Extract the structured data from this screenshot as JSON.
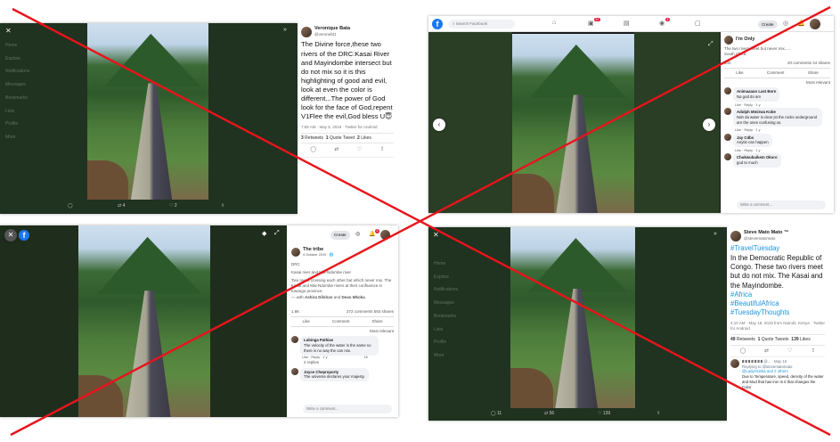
{
  "panel_tl": {
    "user_name": "Veronique Bata",
    "user_handle": "@veronebt1",
    "text": "The Divine force,these two rivers of the DRC:Kasai River and Mayindombe intersect but do not mix so it is this highlighting of good and evil, look at even the color is different...The power of God look for the face of God,repent V1Flee the evil,God bless U😇",
    "meta": "7:58 AM · May 5, 2019 · Twitter for Android",
    "retweets": "3",
    "retweets_label": "Retweets",
    "quote": "1",
    "quote_label": "Quote Tweet",
    "likes": "2",
    "likes_label": "Likes",
    "bar_retweets": "4",
    "bar_likes": "2"
  },
  "panel_tr": {
    "search_placeholder": "Search Facebook",
    "create_label": "Create",
    "badge1": "9+",
    "badge2": "4",
    "poster": "I'm Only",
    "text_line1": "The two rivers meet but never mix......",
    "text_line2": "South Africa.",
    "reactions": "102",
    "comments_shares": "20 comments 44 shares",
    "like_label": "Like",
    "comment_label": "Comment",
    "share_label": "Share",
    "sort_label": "Most relevant",
    "comments": [
      {
        "name": "Animaaaun Last Born",
        "text": "Na god do am"
      },
      {
        "name": "Adolph Mmirwa Kobe",
        "text": "Nah da water is clear jst the rocks underground are the ones confusing us."
      },
      {
        "name": "Jay Cdbs",
        "text": "Anytin can happen"
      },
      {
        "name": "Chukwubuikem Okoro",
        "text": "god to much"
      }
    ],
    "meta_like": "Like · Reply · 1 y",
    "write_comment": "Write a comment..."
  },
  "panel_bl": {
    "create_label": "Create",
    "badge": "2",
    "page_name": "The tribe",
    "date": "4 October 2019 · 🌐",
    "line1": "DRC",
    "line2": "Kasai river and Mai-Ndombe river",
    "line3": "Two rivers crossing each other but which never mix. The Kasai and Mai-Ndombe rivers at their confluence in Kwango province.",
    "line4_prefix": "— with ",
    "with1": "Ashira Dilshan",
    "with_and": " and ",
    "with2": "Dean Mkoka",
    "reactions": "1.6K",
    "comments_shares": "272 comments 593 shares",
    "like_label": "Like",
    "comment_label": "Comment",
    "share_label": "Share",
    "sort_label": "Most relevant",
    "comment1_name": "Lubinga Pathias",
    "comment1_text": "The velocity of the water is the same so there is no way the can mix.",
    "comment1_meta": "Like · Reply · 1 y",
    "comment1_count": "16",
    "replies": "2 replies",
    "comment2_name": "Joyce Cheproporty",
    "comment2_text": "The universe declares your majesty.",
    "write_comment": "Write a comment..."
  },
  "panel_br": {
    "user_name": "Steve Mato Mato ™",
    "user_handle": "@stevematomato",
    "hashtag1": "#TravelTuesday",
    "text": "In the Democratic Republic of Congo. These two rivers meet but do not mix. The Kasai and the Mayindombe.",
    "hashtag2": "#Africa",
    "hashtag3": "#BeautifulAfrica",
    "hashtag4": "#TuesdayThoughts",
    "meta": "4:10 AM · May 18, 2019 from Nairobi, Kenya · Twitter for Android",
    "retweets": "49",
    "retweets_label": "Retweets",
    "quote": "1",
    "quote_label": "Quote Tweets",
    "likes": "139",
    "likes_label": "Likes",
    "reply_name": "ಠ ಠ ಠ ಠ ಠ ಠ ಠ",
    "reply_handle": "@... · May 16",
    "reply_to": "Replying to @stevematomato",
    "reply_to2": "@LadyAkinka and 2 others",
    "reply_text": "Due to Temperature, speed, density of the water and Mud that has iron in it that changes the Color",
    "bar_replies": "11",
    "bar_retweets": "56",
    "bar_likes": "139"
  },
  "colors": {
    "cross": "#e8141b",
    "twitter_blue": "#1b95e0",
    "facebook_blue": "#1877f2"
  }
}
